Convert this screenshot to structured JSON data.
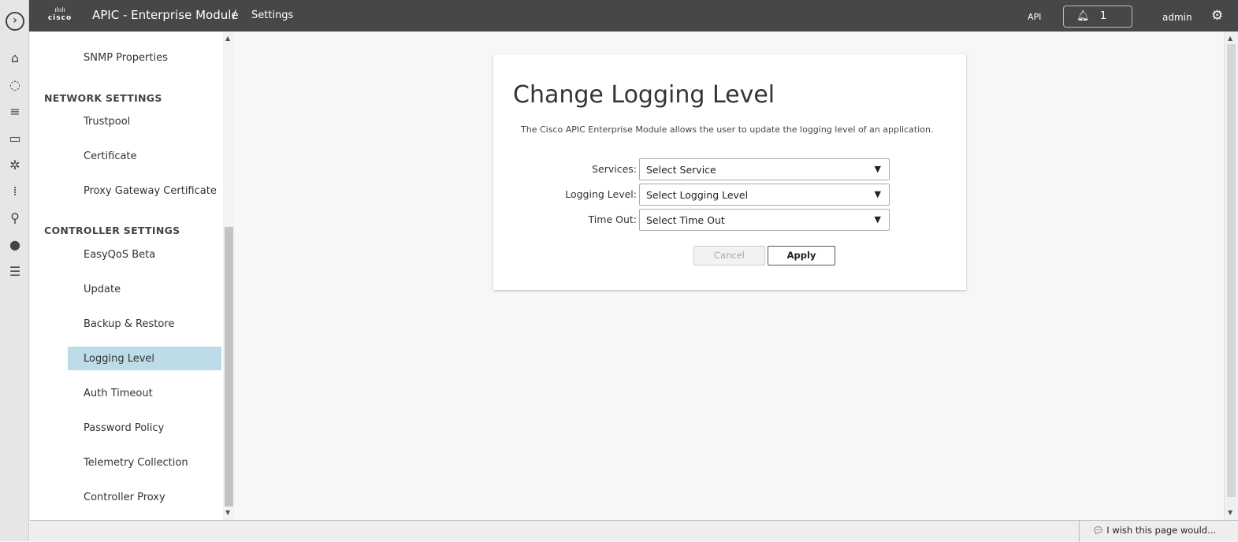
{
  "header": {
    "app_title": "APIC - Enterprise Module",
    "separator": "/",
    "breadcrumb": "Settings",
    "api_label": "API",
    "notification_count": "1",
    "user": "admin",
    "logo_text": "CISCO"
  },
  "sidebar": {
    "items": [
      {
        "type": "item",
        "label": "SNMP Properties"
      },
      {
        "type": "header",
        "label": "NETWORK SETTINGS"
      },
      {
        "type": "item",
        "label": "Trustpool"
      },
      {
        "type": "item",
        "label": "Certificate"
      },
      {
        "type": "item",
        "label": "Proxy Gateway Certificate"
      },
      {
        "type": "header",
        "label": "CONTROLLER SETTINGS"
      },
      {
        "type": "item",
        "label": "EasyQoS Beta"
      },
      {
        "type": "item",
        "label": "Update"
      },
      {
        "type": "item",
        "label": "Backup & Restore"
      },
      {
        "type": "item",
        "label": "Logging Level",
        "active": true
      },
      {
        "type": "item",
        "label": "Auth Timeout"
      },
      {
        "type": "item",
        "label": "Password Policy"
      },
      {
        "type": "item",
        "label": "Telemetry Collection"
      },
      {
        "type": "item",
        "label": "Controller Proxy"
      }
    ]
  },
  "main": {
    "title": "Change Logging Level",
    "description": "The Cisco APIC Enterprise Module allows the user to update the logging level of an application.",
    "fields": [
      {
        "label": "Services:",
        "value": "Select Service"
      },
      {
        "label": "Logging Level:",
        "value": "Select Logging Level"
      },
      {
        "label": "Time Out:",
        "value": "Select Time Out"
      }
    ],
    "cancel_label": "Cancel",
    "apply_label": "Apply"
  },
  "footer": {
    "feedback": "I wish this page would..."
  },
  "colors": {
    "topbar": "#474747",
    "active_item": "#bcdde7"
  }
}
